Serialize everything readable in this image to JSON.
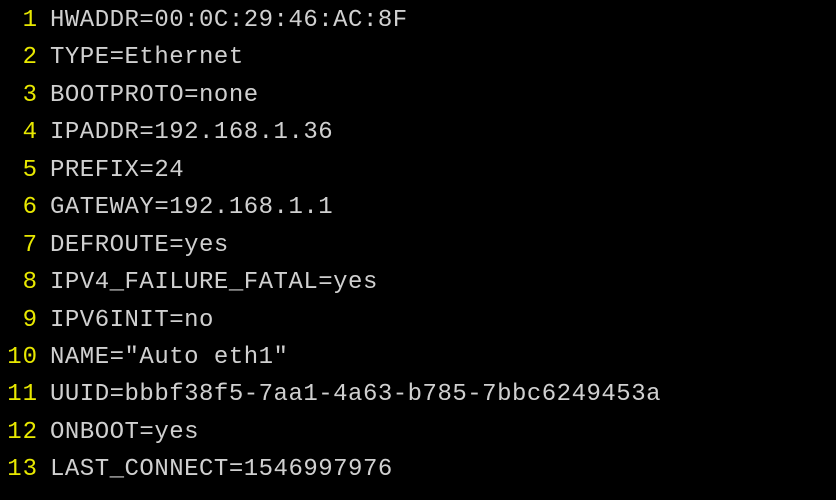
{
  "editor": {
    "lines": [
      {
        "number": "1",
        "text": "HWADDR=00:0C:29:46:AC:8F"
      },
      {
        "number": "2",
        "text": "TYPE=Ethernet"
      },
      {
        "number": "3",
        "text": "BOOTPROTO=none"
      },
      {
        "number": "4",
        "text": "IPADDR=192.168.1.36"
      },
      {
        "number": "5",
        "text": "PREFIX=24"
      },
      {
        "number": "6",
        "text": "GATEWAY=192.168.1.1"
      },
      {
        "number": "7",
        "text": "DEFROUTE=yes"
      },
      {
        "number": "8",
        "text": "IPV4_FAILURE_FATAL=yes"
      },
      {
        "number": "9",
        "text": "IPV6INIT=no"
      },
      {
        "number": "10",
        "text": "NAME=\"Auto eth1\""
      },
      {
        "number": "11",
        "text": "UUID=bbbf38f5-7aa1-4a63-b785-7bbc6249453a"
      },
      {
        "number": "12",
        "text": "ONBOOT=yes"
      },
      {
        "number": "13",
        "text": "LAST_CONNECT=1546997976"
      }
    ]
  }
}
